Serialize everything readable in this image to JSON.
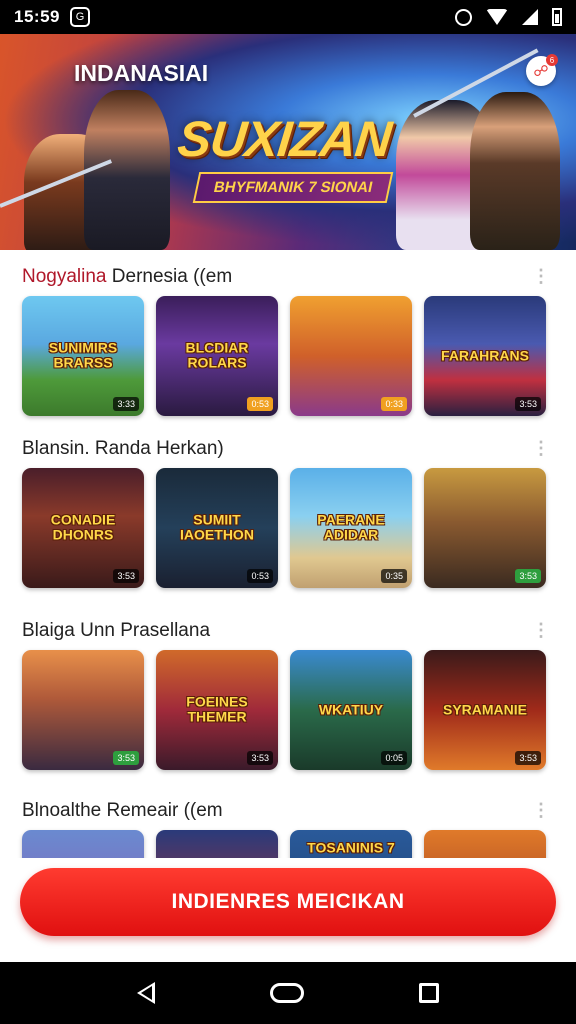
{
  "status_bar": {
    "time": "15:59",
    "notification_glyph": "G",
    "icons": [
      "alarm-icon",
      "wifi-icon",
      "signal-icon",
      "battery-icon"
    ]
  },
  "banner": {
    "app_name": "INDANASIAI",
    "hero_title": "SUXIZAN",
    "hero_subtitle": "BHYFMANIK 7 SIONAI",
    "notification_count": "6"
  },
  "sections": [
    {
      "title_accent": "Nogyalina",
      "title_rest": " Dernesia ((em",
      "cards": [
        {
          "label": "SUNIMIRS BRARSS",
          "badge": "3:33",
          "bg": "linear-gradient(#6ec8f0,#5aa8e0 40%,#4e9a3a 70%,#3c7a2c)",
          "badge_style": ""
        },
        {
          "label": "BLCDIAR ROLARS",
          "badge": "0:53",
          "bg": "linear-gradient(#3a1e5a,#6a3aa0 40%,#2a1a40)",
          "badge_style": "orange"
        },
        {
          "label": "",
          "badge": "0:33",
          "bg": "linear-gradient(#f0a030,#d0602a 50%,#8a3a8a)",
          "badge_style": "orange"
        },
        {
          "label": "FARAHRANS",
          "badge": "3:53",
          "bg": "linear-gradient(#2a3a7a,#4a5ab0 40%,#c03040 70%,#2a2040)",
          "badge_style": ""
        }
      ]
    },
    {
      "title_accent": "",
      "title_rest": "Blansin. Randa Herkan)",
      "cards": [
        {
          "label": "CONADIE DHONRS",
          "badge": "3:53",
          "bg": "linear-gradient(#4a1e2a,#8a3a2a 40%,#3a1a1a)",
          "badge_style": ""
        },
        {
          "label": "SUMIIT IAOETHON",
          "badge": "0:53",
          "bg": "linear-gradient(#1a2a3a,#24405a 50%,#1a2030)",
          "badge_style": ""
        },
        {
          "label": "PAERANE ADIDAR",
          "badge": "0:35",
          "bg": "linear-gradient(#5ab0e8,#8ad0f0 40%,#e0c890 75%,#c0a070)",
          "badge_style": ""
        },
        {
          "label": "",
          "badge": "3:53",
          "bg": "linear-gradient(#c89a40,#8a5a30 45%,#3a2a20)",
          "badge_style": "green"
        }
      ]
    },
    {
      "title_accent": "",
      "title_rest": "Blaiga Unn Prasellana",
      "cards": [
        {
          "label": "",
          "badge": "3:53",
          "bg": "linear-gradient(#e8904a,#b05a3a 40%,#3a2a40)",
          "badge_style": "green"
        },
        {
          "label": "FOEINES THEMER",
          "badge": "3:53",
          "bg": "linear-gradient(#d06a2a,#a02a3a 50%,#3a1a2a)",
          "badge_style": ""
        },
        {
          "label": "WKATIUY",
          "badge": "0:05",
          "bg": "linear-gradient(#3a8ad0,#2a6a4a 50%,#1a3a2a)",
          "badge_style": ""
        },
        {
          "label": "SYRAMANIE",
          "badge": "3:53",
          "bg": "linear-gradient(#3a1a1a,#a02a1a 50%,#e07a2a)",
          "badge_style": ""
        }
      ]
    },
    {
      "title_accent": "",
      "title_rest": "Blnoalthe Remeair ((em",
      "cards": [
        {
          "label": "",
          "badge": "",
          "bg": "linear-gradient(#6a8ad0,#8a5ab0)",
          "badge_style": ""
        },
        {
          "label": "",
          "badge": "",
          "bg": "linear-gradient(#2a3a7a,#c0302a)",
          "badge_style": ""
        },
        {
          "label": "TOSANINIS 7",
          "badge": "",
          "bg": "linear-gradient(#2a5a9a,#1a3a6a)",
          "badge_style": ""
        },
        {
          "label": "",
          "badge": "",
          "bg": "linear-gradient(#e07a2a,#8a2a1a)",
          "badge_style": ""
        }
      ]
    }
  ],
  "cta": {
    "label": "INDIENRES MEICIKAN"
  },
  "nav_bar": {
    "icons": [
      "back-icon",
      "home-icon",
      "recents-icon"
    ]
  }
}
